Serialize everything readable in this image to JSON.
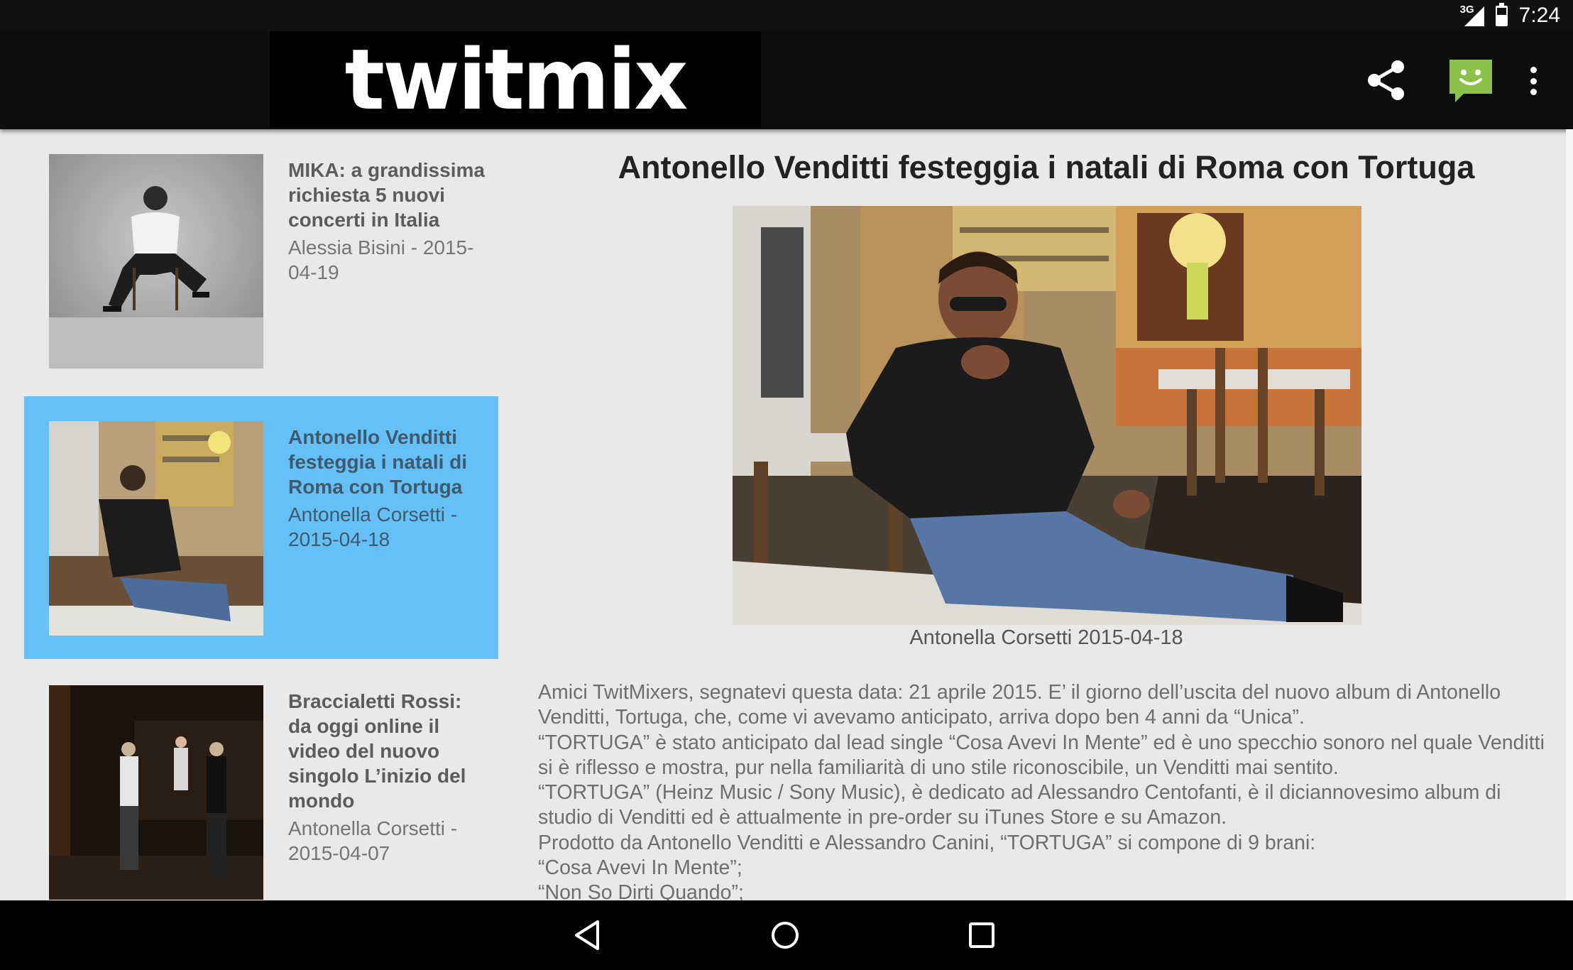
{
  "status_bar": {
    "network": "3G",
    "time": "7:24"
  },
  "app_bar": {
    "logo": "twitmix"
  },
  "colors": {
    "selected_item_bg": "#64c0f6",
    "chat_icon": "#8bc34a",
    "app_bar_bg": "#0d0d0d"
  },
  "list": [
    {
      "title": "MIKA: a grandissima richiesta 5 nuovi concerti in Italia",
      "meta": "Alessia Bisini - 2015-04-19",
      "selected": false
    },
    {
      "title": "Antonello Venditti festeggia i natali di Roma con Tortuga",
      "meta": "Antonella Corsetti - 2015-04-18",
      "selected": true
    },
    {
      "title": "Braccialetti Rossi: da oggi online il video del nuovo singolo L’inizio del mondo",
      "meta": "Antonella Corsetti - 2015-04-07",
      "selected": false
    }
  ],
  "article": {
    "title": "Antonello Venditti festeggia i natali di Roma con Tortuga",
    "caption": "Antonella Corsetti 2015-04-18",
    "body": [
      "Amici TwitMixers, segnatevi questa data: 21 aprile 2015. E’ il giorno dell’uscita del nuovo album di Antonello Venditti, Tortuga, che, come vi avevamo anticipato, arriva dopo ben 4 anni da “Unica”.",
      "“TORTUGA” è stato anticipato dal lead single “Cosa Avevi In Mente” ed è uno specchio sonoro nel quale Venditti si è riflesso e mostra, pur nella familiarità di uno stile riconoscibile, un Venditti mai sentito.",
      "“TORTUGA” (Heinz Music / Sony Music), è dedicato ad Alessandro Centofanti, è il diciannovesimo album di studio di Venditti ed è attualmente in pre-order su iTunes Store e su Amazon.",
      "Prodotto da Antonello Venditti e Alessandro Canini, “TORTUGA” si compone di 9 brani:",
      "“Cosa Avevi In Mente”;",
      "“Non So Dirti Quando”;"
    ]
  },
  "icons": {
    "share": "share-icon",
    "chat": "chat-smiley-icon",
    "menu": "more-vertical-icon",
    "back": "back-triangle-icon",
    "home": "home-circle-icon",
    "recents": "recents-square-icon"
  }
}
